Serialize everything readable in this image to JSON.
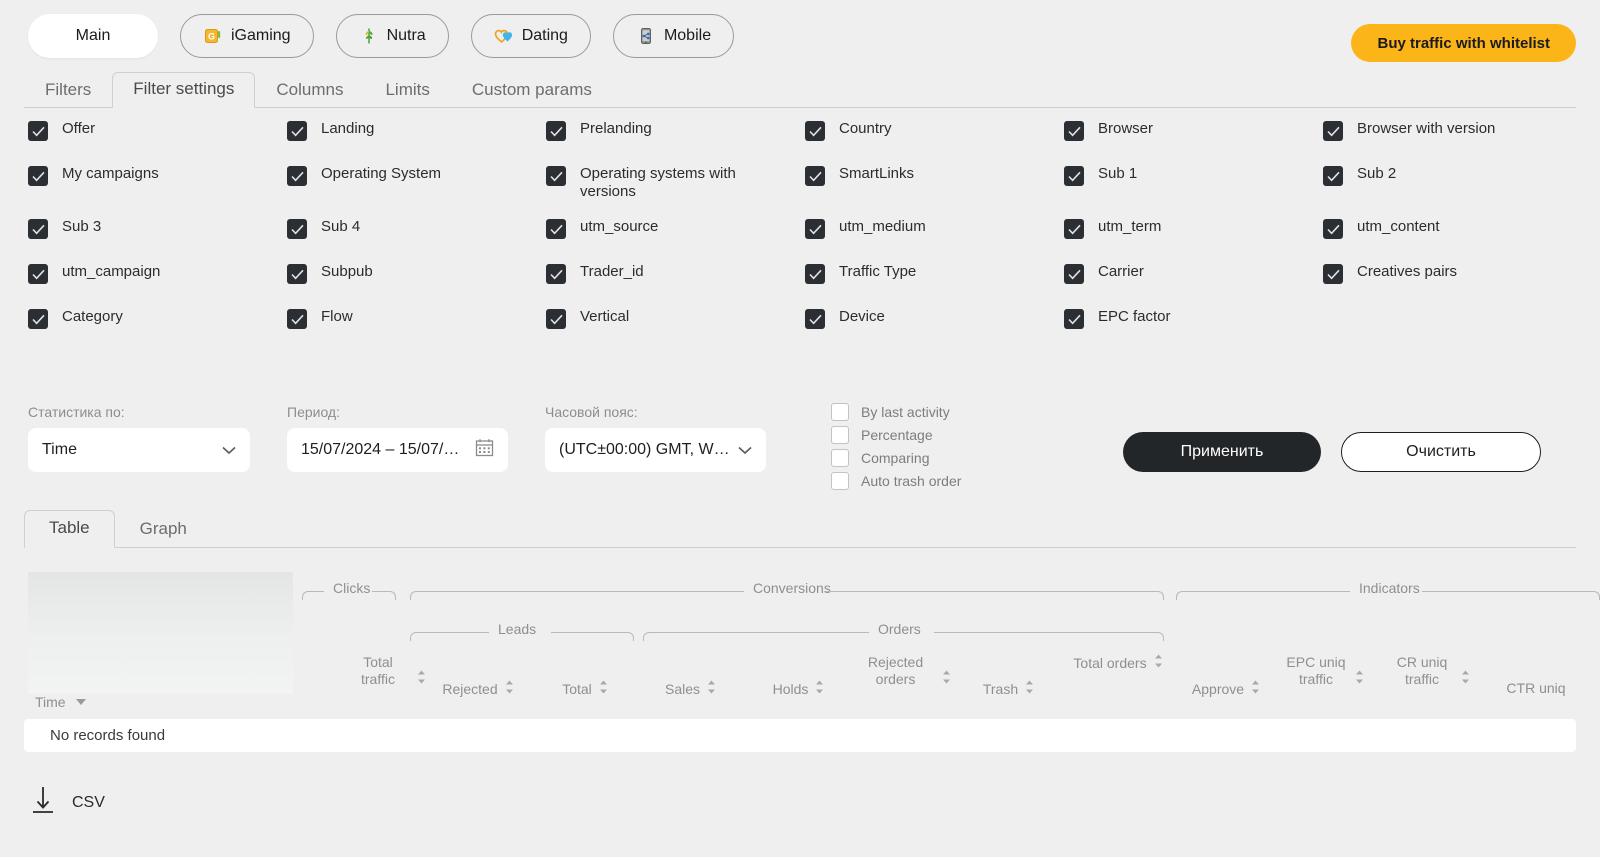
{
  "top": {
    "tabs": [
      {
        "label": "Main",
        "icon": "none",
        "active": true
      },
      {
        "label": "iGaming",
        "icon": "slot-machine-icon",
        "active": false
      },
      {
        "label": "Nutra",
        "icon": "leaf-icon",
        "active": false
      },
      {
        "label": "Dating",
        "icon": "hearts-icon",
        "active": false
      },
      {
        "label": "Mobile",
        "icon": "mobile-phone-icon",
        "active": false
      }
    ],
    "buy_button": "Buy traffic with whitelist",
    "accent_yellow": "#fcb519"
  },
  "subtabs": [
    {
      "label": "Filters",
      "active": false
    },
    {
      "label": "Filter settings",
      "active": true
    },
    {
      "label": "Columns",
      "active": false
    },
    {
      "label": "Limits",
      "active": false
    },
    {
      "label": "Custom params",
      "active": false
    }
  ],
  "filter_settings": {
    "checkboxes": [
      {
        "label": "Offer",
        "checked": true
      },
      {
        "label": "Landing",
        "checked": true
      },
      {
        "label": "Prelanding",
        "checked": true
      },
      {
        "label": "Country",
        "checked": true
      },
      {
        "label": "Browser",
        "checked": true
      },
      {
        "label": "Browser with version",
        "checked": true
      },
      {
        "label": "My campaigns",
        "checked": true
      },
      {
        "label": "Operating System",
        "checked": true
      },
      {
        "label": "Operating systems with versions",
        "checked": true
      },
      {
        "label": "SmartLinks",
        "checked": true
      },
      {
        "label": "Sub 1",
        "checked": true
      },
      {
        "label": "Sub 2",
        "checked": true
      },
      {
        "label": "Sub 3",
        "checked": true
      },
      {
        "label": "Sub 4",
        "checked": true
      },
      {
        "label": "utm_source",
        "checked": true
      },
      {
        "label": "utm_medium",
        "checked": true
      },
      {
        "label": "utm_term",
        "checked": true
      },
      {
        "label": "utm_content",
        "checked": true
      },
      {
        "label": "utm_campaign",
        "checked": true
      },
      {
        "label": "Subpub",
        "checked": true
      },
      {
        "label": "Trader_id",
        "checked": true
      },
      {
        "label": "Traffic Type",
        "checked": true
      },
      {
        "label": "Carrier",
        "checked": true
      },
      {
        "label": "Creatives pairs",
        "checked": true
      },
      {
        "label": "Category",
        "checked": true
      },
      {
        "label": "Flow",
        "checked": true
      },
      {
        "label": "Vertical",
        "checked": true
      },
      {
        "label": "Device",
        "checked": true
      },
      {
        "label": "EPC factor",
        "checked": true
      }
    ]
  },
  "controls": {
    "stats_by": {
      "label": "Статистика по:",
      "value": "Time"
    },
    "period": {
      "label": "Период:",
      "value": "15/07/2024 – 15/07/…",
      "icon": "calendar-icon"
    },
    "timezone": {
      "label": "Часовой пояс:",
      "value": "(UTC±00:00) GMT, W…"
    },
    "options": [
      {
        "label": "By last activity",
        "checked": false
      },
      {
        "label": "Percentage",
        "checked": false
      },
      {
        "label": "Comparing",
        "checked": false
      },
      {
        "label": "Auto trash order",
        "checked": false
      }
    ],
    "apply_button": "Применить",
    "clear_button": "Очистить"
  },
  "view_tabs": [
    {
      "label": "Table",
      "active": true
    },
    {
      "label": "Graph",
      "active": false
    }
  ],
  "table": {
    "row_label": "Time",
    "groups_top": [
      {
        "label": "Clicks"
      },
      {
        "label": "Conversions"
      },
      {
        "label": "Indicators"
      }
    ],
    "groups_sub": [
      {
        "label": "Leads"
      },
      {
        "label": "Orders"
      }
    ],
    "columns": [
      {
        "label": "Total traffic",
        "sortable": true
      },
      {
        "label": "Rejected",
        "sortable": true
      },
      {
        "label": "Total",
        "sortable": true
      },
      {
        "label": "Sales",
        "sortable": true
      },
      {
        "label": "Holds",
        "sortable": true
      },
      {
        "label": "Rejected orders",
        "sortable": true
      },
      {
        "label": "Trash",
        "sortable": true
      },
      {
        "label": "Total orders",
        "sortable": true
      },
      {
        "label": "Approve",
        "sortable": true
      },
      {
        "label": "EPC uniq traffic",
        "sortable": true
      },
      {
        "label": "CR uniq traffic",
        "sortable": true
      },
      {
        "label": "CTR uniq",
        "sortable": false
      }
    ],
    "empty_message": "No records found"
  },
  "footer": {
    "csv_label": "CSV",
    "csv_icon": "download-icon"
  }
}
